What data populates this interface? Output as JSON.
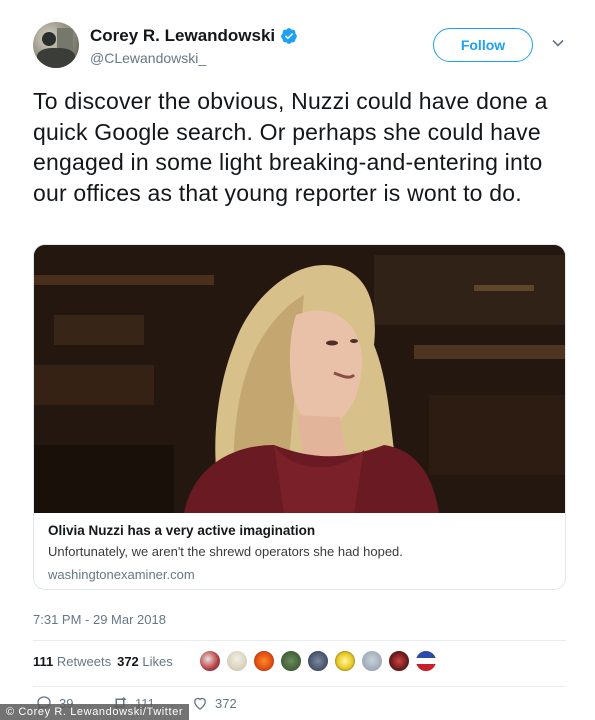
{
  "author": {
    "display_name": "Corey R. Lewandowski",
    "handle": "@CLewandowski_",
    "verified_icon": "verified-badge-icon"
  },
  "follow_label": "Follow",
  "tweet_text": "To discover the obvious, Nuzzi could have done a quick Google search. Or perhaps she could have engaged in some light breaking-and-entering into our offices as that young reporter is wont to do.",
  "card": {
    "title": "Olivia Nuzzi has a very active imagination",
    "description": "Unfortunately, we aren't the shrewd operators she had hoped.",
    "domain": "washingtonexaminer.com"
  },
  "timestamp": "7:31 PM - 29 Mar 2018",
  "stats": {
    "retweets_count": "111",
    "retweets_label": "Retweets",
    "likes_count": "372",
    "likes_label": "Likes"
  },
  "actions": {
    "reply_count": "39",
    "retweet_count": "111",
    "like_count": "372"
  },
  "watermark": "© Corey R. Lewandowski/Twitter",
  "colors": {
    "accent": "#1da1f2",
    "text": "#14171a",
    "muted": "#657786"
  }
}
